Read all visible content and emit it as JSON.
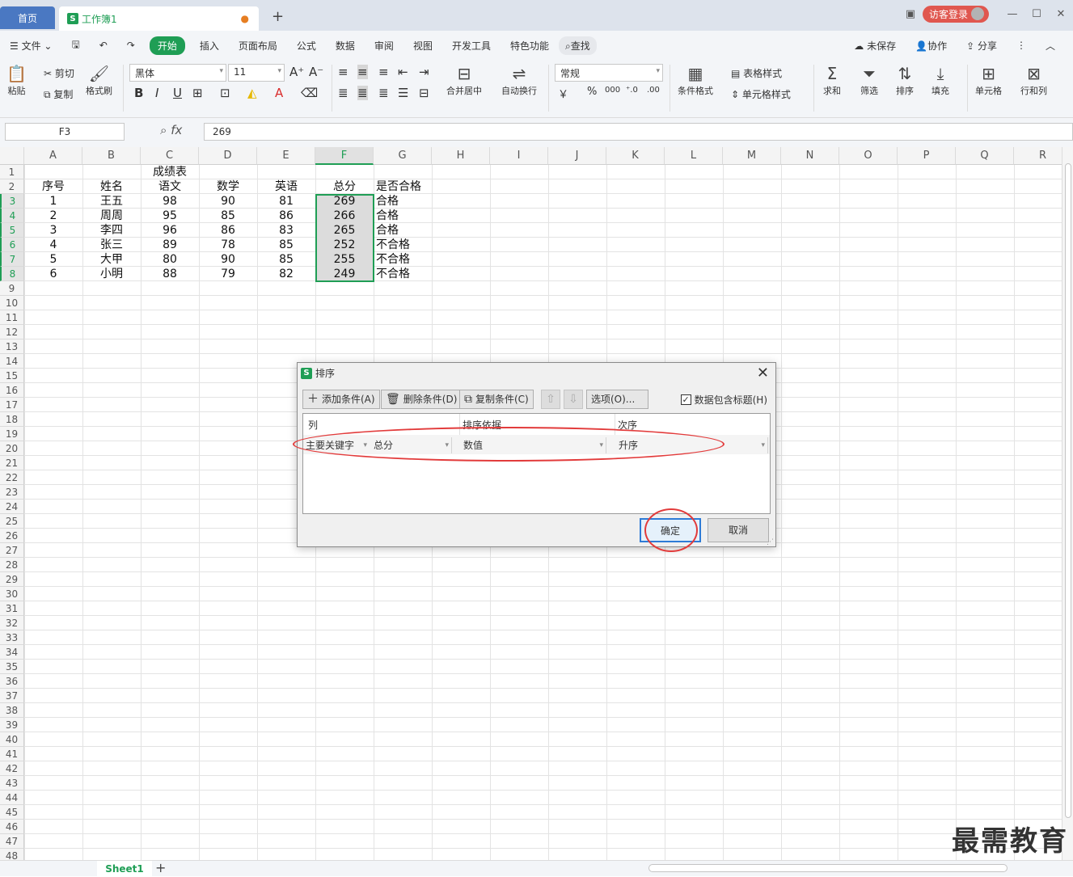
{
  "titlebar": {
    "home_tab": "首页",
    "workbook_tab": "工作簿1",
    "login": "访客登录",
    "new_tab": "+"
  },
  "menu": {
    "file": "文件",
    "items": [
      "插入",
      "页面布局",
      "公式",
      "数据",
      "审阅",
      "视图",
      "开发工具",
      "特色功能"
    ],
    "start": "开始",
    "search": "查找",
    "unsaved": "未保存",
    "collab": "协作",
    "share": "分享"
  },
  "ribbon": {
    "paste": "粘贴",
    "cut": "剪切",
    "copy": "复制",
    "format_painter": "格式刷",
    "font": "黑体",
    "font_size": "11",
    "merge": "合并居中",
    "wrap": "自动换行",
    "number_format": "常规",
    "currency": "￥",
    "percent": "%",
    "cond_format": "条件格式",
    "table_style": "表格样式",
    "cell_style": "单元格样式",
    "sum": "求和",
    "filter": "筛选",
    "sort": "排序",
    "fill": "填充",
    "cells": "单元格",
    "rowcol": "行和列"
  },
  "formula_bar": {
    "name_box": "F3",
    "fx": "fx",
    "value": "269"
  },
  "columns": [
    "A",
    "B",
    "C",
    "D",
    "E",
    "F",
    "G",
    "H",
    "I",
    "J",
    "K",
    "L",
    "M",
    "N",
    "O",
    "P",
    "Q",
    "R"
  ],
  "sheet": {
    "title": "成绩表",
    "headers": [
      "序号",
      "姓名",
      "语文",
      "数学",
      "英语",
      "总分",
      "是否合格"
    ],
    "rows": [
      [
        "1",
        "王五",
        "98",
        "90",
        "81",
        "269",
        "合格"
      ],
      [
        "2",
        "周周",
        "95",
        "85",
        "86",
        "266",
        "合格"
      ],
      [
        "3",
        "李四",
        "96",
        "86",
        "83",
        "265",
        "合格"
      ],
      [
        "4",
        "张三",
        "89",
        "78",
        "85",
        "252",
        "不合格"
      ],
      [
        "5",
        "大甲",
        "80",
        "90",
        "85",
        "255",
        "不合格"
      ],
      [
        "6",
        "小明",
        "88",
        "79",
        "82",
        "249",
        "不合格"
      ]
    ]
  },
  "sheet_tabs": {
    "active": "Sheet1",
    "add": "+"
  },
  "dialog": {
    "title": "排序",
    "add_condition": "添加条件(A)",
    "delete_condition": "删除条件(D)",
    "copy_condition": "复制条件(C)",
    "options": "选项(O)...",
    "has_header": "数据包含标题(H)",
    "col_header": "列",
    "basis_header": "排序依据",
    "order_header": "次序",
    "key_label": "主要关键字",
    "key_value": "总分",
    "basis_value": "数值",
    "order_value": "升序",
    "ok": "确定",
    "cancel": "取消"
  },
  "watermark": "最需教育"
}
